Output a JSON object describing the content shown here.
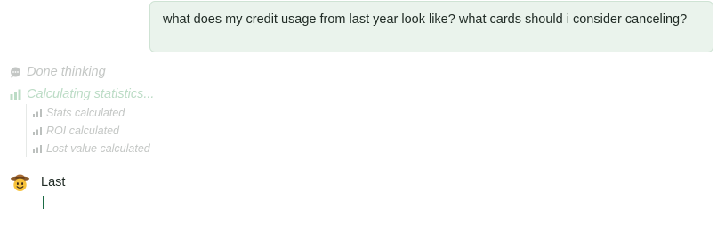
{
  "user_message": {
    "text": "what does my credit usage from last year look like? what cards should i consider canceling?"
  },
  "thinking": {
    "done_label": "Done thinking",
    "done_icon": "speech-bubble-icon",
    "calculating_label": "Calculating statistics...",
    "calculating_icon": "bar-chart-icon",
    "steps": [
      {
        "label": "Stats calculated",
        "icon": "bar-chart-icon"
      },
      {
        "label": "ROI calculated",
        "icon": "bar-chart-icon"
      },
      {
        "label": "Lost value calculated",
        "icon": "bar-chart-icon"
      }
    ]
  },
  "assistant": {
    "name": "Last",
    "avatar_icon": "cowboy-face-icon"
  },
  "colors": {
    "user_bubble_bg": "#eaf3ec",
    "muted_text": "#c4c7c5",
    "active_status": "#bcdcc6",
    "cursor": "#1c6b45"
  }
}
